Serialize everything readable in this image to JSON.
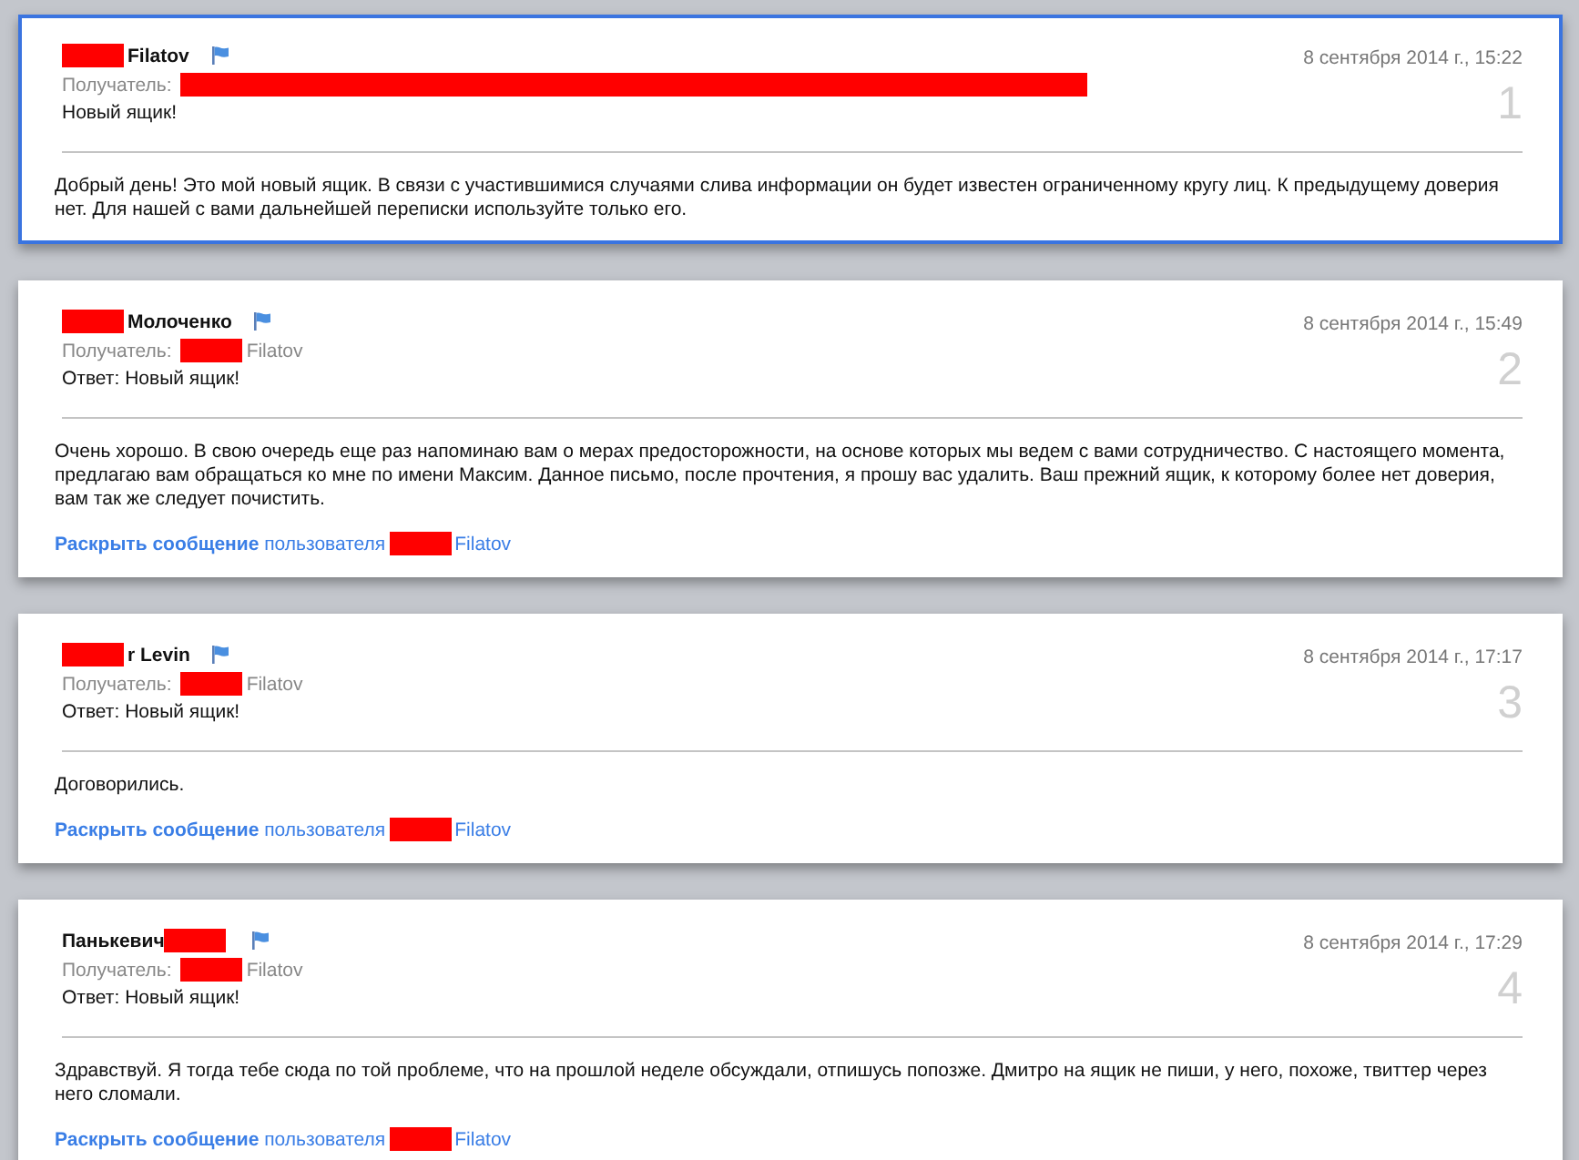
{
  "messages": [
    {
      "selected": true,
      "flagged": true,
      "sender": [
        {
          "kind": "redaction"
        },
        {
          "kind": "text",
          "text": "Filatov"
        }
      ],
      "recipient_label": "Получатель:",
      "recipient": [
        {
          "kind": "long_redaction"
        }
      ],
      "date": "8 сентября 2014 г., 15:22",
      "subject": "Новый ящик!",
      "number": "1",
      "body": "Добрый день! Это мой новый ящик. В связи с участившимися случаями слива информации он будет известен ограниченному кругу лиц. К предыдущему доверия нет. Для нашей с вами дальнейшей переписки используйте только его."
    },
    {
      "selected": false,
      "flagged": true,
      "sender": [
        {
          "kind": "redaction"
        },
        {
          "kind": "text",
          "text": "Молоченко"
        }
      ],
      "recipient_label": "Получатель:",
      "recipient": [
        {
          "kind": "redaction"
        },
        {
          "kind": "text",
          "text": "Filatov"
        }
      ],
      "date": "8 сентября 2014 г., 15:49",
      "subject": "Ответ: Новый ящик!",
      "number": "2",
      "body": "Очень хорошо. В свою очередь еще раз напоминаю вам о мерах предосторожности, на основе которых мы ведем с вами сотрудничество. С настоящего момента, предлагаю вам обращаться ко мне по имени Максим. Данное письмо, после прочтения, я прошу вас удалить. Ваш прежний ящик, к которому более нет доверия, вам так же следует почистить.",
      "expand": [
        {
          "kind": "text",
          "text": "**Раскрыть сообщение** пользователя"
        },
        {
          "kind": "redaction"
        },
        {
          "kind": "text",
          "text": "Filatov"
        }
      ]
    },
    {
      "selected": false,
      "flagged": true,
      "sender": [
        {
          "kind": "redaction"
        },
        {
          "kind": "text",
          "text": "r Levin"
        }
      ],
      "recipient_label": "Получатель:",
      "recipient": [
        {
          "kind": "redaction"
        },
        {
          "kind": "text",
          "text": "Filatov"
        }
      ],
      "date": "8 сентября 2014 г., 17:17",
      "subject": "Ответ: Новый ящик!",
      "number": "3",
      "body": "Договорились.",
      "expand": [
        {
          "kind": "text",
          "text": "**Раскрыть сообщение** пользователя"
        },
        {
          "kind": "redaction"
        },
        {
          "kind": "text",
          "text": "Filatov"
        }
      ]
    },
    {
      "selected": false,
      "flagged": true,
      "sender": [
        {
          "kind": "text",
          "text": "Панькевич"
        },
        {
          "kind": "redaction"
        }
      ],
      "recipient_label": "Получатель:",
      "recipient": [
        {
          "kind": "redaction"
        },
        {
          "kind": "text",
          "text": "Filatov"
        }
      ],
      "date": "8 сентября 2014 г., 17:29",
      "subject": "Ответ: Новый ящик!",
      "number": "4",
      "body": "Здравствуй. Я тогда тебе сюда по той проблеме, что на прошлой неделе обсуждали, отпишусь попозже. Дмитро на ящик не пиши, у него, похоже, твиттер через него сломали.",
      "expand": [
        {
          "kind": "text",
          "text": "**Раскрыть сообщение** пользователя"
        },
        {
          "kind": "redaction"
        },
        {
          "kind": "text",
          "text": "Filatov"
        }
      ]
    }
  ]
}
